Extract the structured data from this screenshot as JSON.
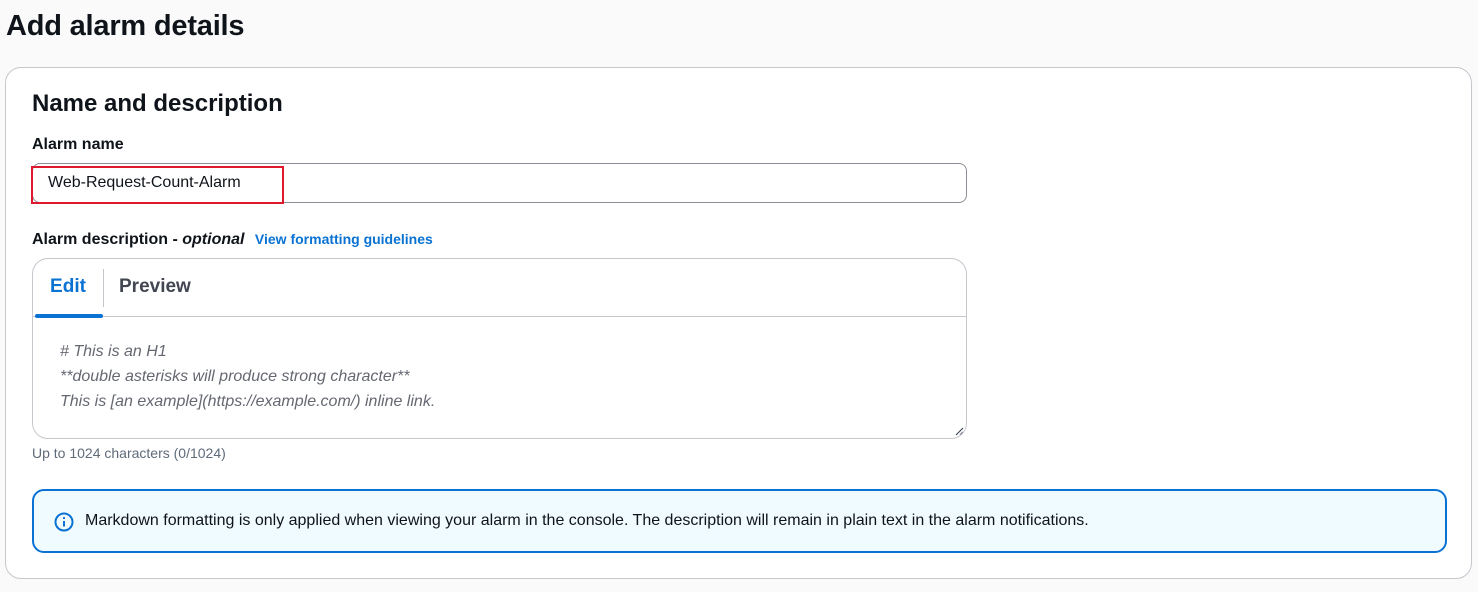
{
  "page": {
    "title": "Add alarm details"
  },
  "section": {
    "title": "Name and description"
  },
  "alarm_name": {
    "label": "Alarm name",
    "value": "Web-Request-Count-Alarm"
  },
  "alarm_description": {
    "label": "Alarm description",
    "separator": " - ",
    "optional": "optional",
    "link": "View formatting guidelines",
    "tabs": [
      "Edit",
      "Preview"
    ],
    "active_tab": "Edit",
    "placeholder_lines": [
      "# This is an H1",
      "**double asterisks will produce strong character**",
      "This is [an example](https://example.com/) inline link."
    ],
    "constraint": "Up to 1024 characters (0/1024)"
  },
  "info_alert": {
    "icon": "info-icon",
    "text": "Markdown formatting is only applied when viewing your alarm in the console. The description will remain in plain text in the alarm notifications."
  },
  "colors": {
    "accent": "#0972d3",
    "highlight": "#e0182d",
    "alert_background": "#f0fbff"
  }
}
